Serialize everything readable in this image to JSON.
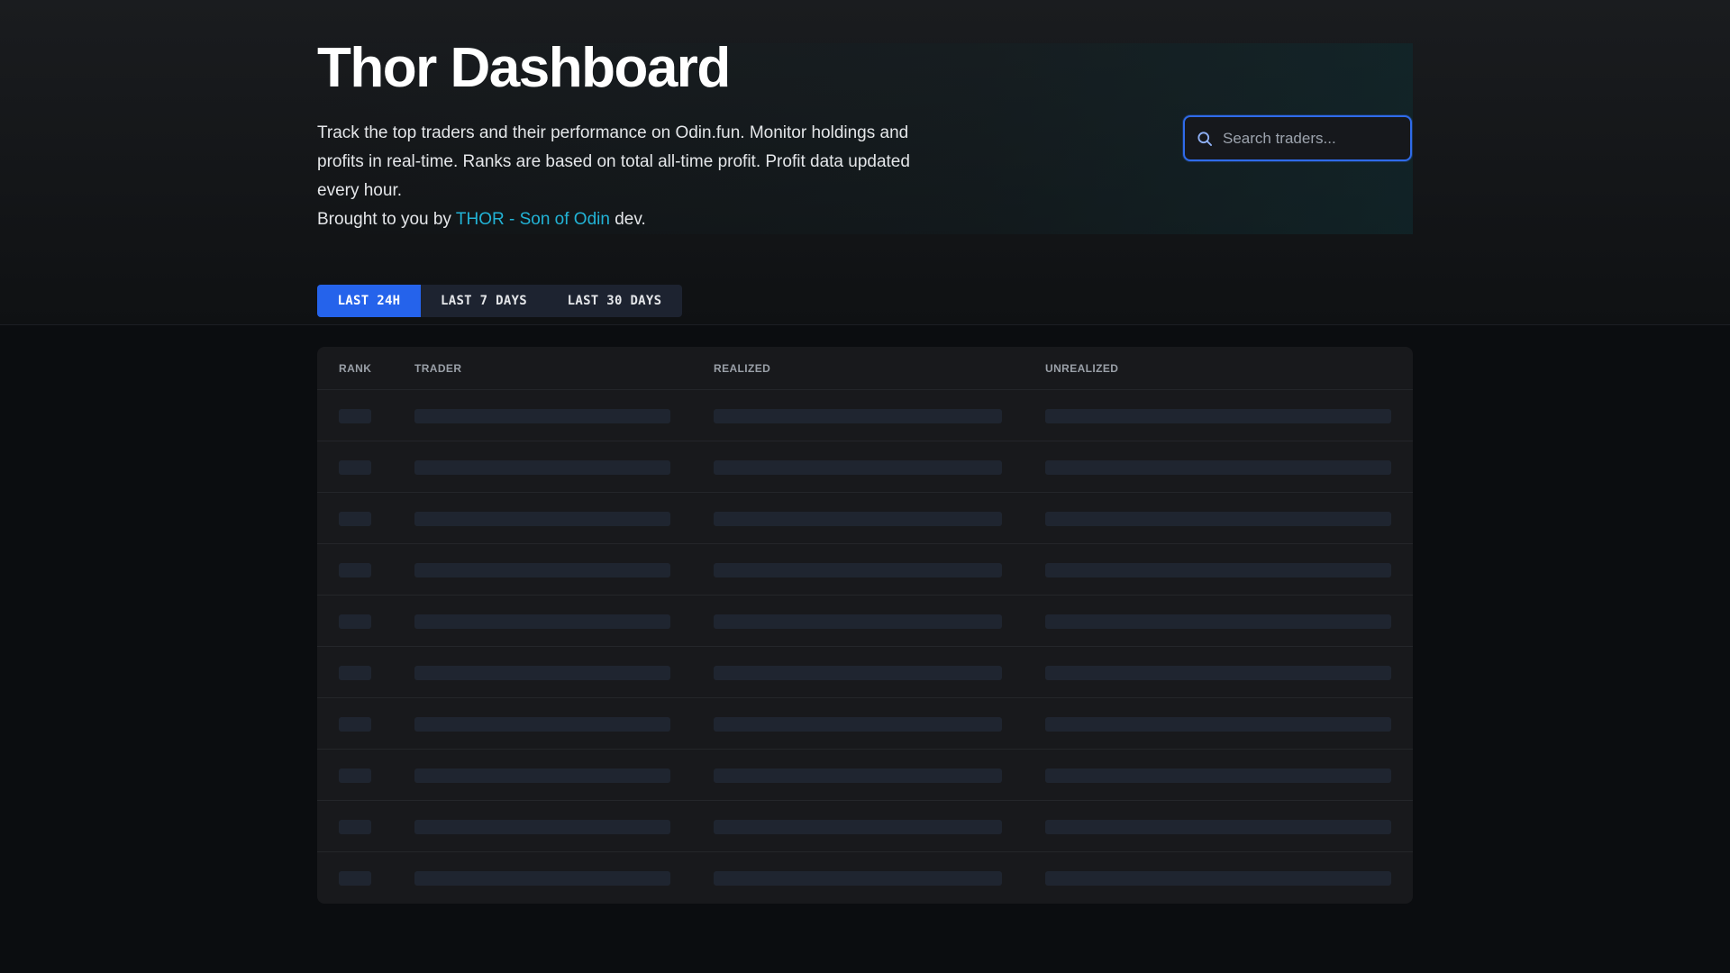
{
  "header": {
    "title": "Thor Dashboard",
    "description": "Track the top traders and their performance on Odin.fun. Monitor holdings and profits in real-time. Ranks are based on total all-time profit. Profit data updated every hour.",
    "byline_prefix": "Brought to you by",
    "byline_link": "THOR - Son of Odin",
    "byline_suffix": "dev."
  },
  "search": {
    "placeholder": "Search traders...",
    "value": ""
  },
  "tabs": [
    {
      "label": "LAST 24H",
      "active": true
    },
    {
      "label": "LAST 7 DAYS",
      "active": false
    },
    {
      "label": "LAST 30 DAYS",
      "active": false
    }
  ],
  "table": {
    "columns": [
      "RANK",
      "TRADER",
      "REALIZED",
      "UNREALIZED"
    ],
    "loading_rows": 10
  },
  "colors": {
    "accent": "#2563eb",
    "link": "#22b3d6",
    "skeleton": "#1f2530"
  }
}
